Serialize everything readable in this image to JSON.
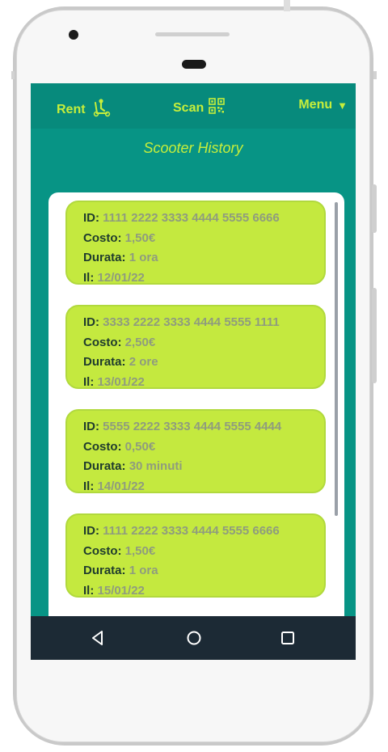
{
  "app_bar": {
    "rent_label": "Rent",
    "scan_label": "Scan",
    "menu_label": "Menu",
    "menu_caret": "▼",
    "accent_color": "#c6ee3b",
    "bar_color": "#078a7c"
  },
  "page_title": "Scooter History",
  "icons": {
    "rent": "scooter-icon",
    "scan": "qr-code-icon",
    "back": "back-triangle-icon",
    "home": "home-circle-icon",
    "recent": "recent-square-icon"
  },
  "history": [
    {
      "id_label": "ID:",
      "id": "1111 2222 3333 4444 5555 6666",
      "cost_label": "Costo:",
      "cost": "1,50€",
      "duration_label": "Durata:",
      "duration": "1 ora",
      "date_label": "Il:",
      "date": "12/01/22"
    },
    {
      "id_label": "ID:",
      "id": "3333 2222 3333 4444 5555 1111",
      "cost_label": "Costo:",
      "cost": "2,50€",
      "duration_label": "Durata:",
      "duration": "2 ore",
      "date_label": "Il:",
      "date": "13/01/22"
    },
    {
      "id_label": "ID:",
      "id": "5555 2222 3333 4444 5555 4444",
      "cost_label": "Costo:",
      "cost": "0,50€",
      "duration_label": "Durata:",
      "duration": "30 minuti",
      "date_label": "Il:",
      "date": "14/01/22"
    },
    {
      "id_label": "ID:",
      "id": "1111 2222 3333 4444 5555 6666",
      "cost_label": "Costo:",
      "cost": "1,50€",
      "duration_label": "Durata:",
      "duration": "1 ora",
      "date_label": "Il:",
      "date": "15/01/22"
    }
  ]
}
